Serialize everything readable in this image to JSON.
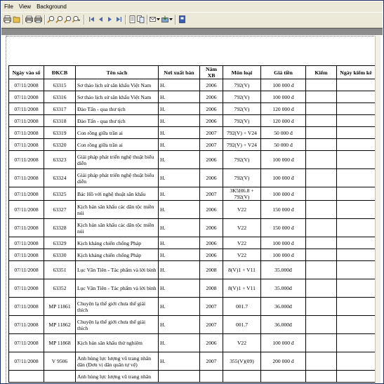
{
  "menu": [
    "File",
    "View",
    "Background"
  ],
  "toolbar_icons": [
    "print-icon",
    "open-icon",
    "print-setup-icon",
    "export-icon",
    "zoom-in-icon",
    "zoom-out-icon",
    "zoom-icon",
    "zoom-dropdown-icon",
    "first-page-icon",
    "prev-page-icon",
    "next-page-icon",
    "last-page-icon",
    "page-icon",
    "multi-page-icon",
    "email-icon",
    "save-icon",
    "watermark-icon",
    "help-icon"
  ],
  "table": {
    "headers": [
      "Ngày vào sổ",
      "ĐKCB",
      "Tên sách",
      "Nơi xuất bản",
      "Năm XB",
      "Môn loại",
      "Giá tiền",
      "Kiểm",
      "Ngày kiểm kê"
    ],
    "rows": [
      [
        "07/11/2008",
        "63315",
        "Sơ thảo lịch sử sân khấu Việt Nam",
        "H.",
        "2006",
        "792(V)",
        "100 000 đ",
        "",
        ""
      ],
      [
        "07/11/2008",
        "63316",
        "Sơ thảo lịch sử sân khấu Việt Nam",
        "H.",
        "2006",
        "792(V)",
        "100 000 đ",
        "",
        ""
      ],
      [
        "07/11/2008",
        "63317",
        "Đào Tấn - qua thư tịch",
        "H.",
        "2006",
        "792(V)",
        "120 000 đ",
        "",
        ""
      ],
      [
        "07/11/2008",
        "63318",
        "Đào Tấn - qua thư tịch",
        "H.",
        "2006",
        "792(V)",
        "120 000 đ",
        "",
        ""
      ],
      [
        "07/11/2008",
        "63319",
        "Con rồng giữa trần ai",
        "H.",
        "2007",
        "792(V) + V24",
        "50 000 đ",
        "",
        ""
      ],
      [
        "07/11/2008",
        "63320",
        "Con rồng giữa trần ai",
        "H.",
        "2007",
        "792(V) + V24",
        "50 000 đ",
        "",
        ""
      ],
      [
        "07/11/2008",
        "63323",
        "Giải pháp phát triển nghệ thuật biểu diễn",
        "H.",
        "2006",
        "792(V)",
        "100 000 đ",
        "",
        ""
      ],
      [
        "07/11/2008",
        "63324",
        "Giải pháp phát triển nghệ thuật biểu diễn",
        "H.",
        "2006",
        "792(V)",
        "100 000 đ",
        "",
        ""
      ],
      [
        "07/11/2008",
        "63325",
        "Bác Hồ với nghệ thuật sân khấu",
        "H.",
        "2007",
        "3K5H6.8 + 792(V)",
        "100 000 đ",
        "",
        ""
      ],
      [
        "07/11/2008",
        "63327",
        "Kịch bản sân khấu các dân tộc miền núi",
        "H.",
        "2006",
        "V22",
        "150 000 đ",
        "",
        ""
      ],
      [
        "07/11/2008",
        "63328",
        "Kịch bản sân khấu các dân tộc miền núi",
        "H.",
        "2006",
        "V22",
        "150 000 đ",
        "",
        ""
      ],
      [
        "07/11/2008",
        "63329",
        "Kịch kháng chiến chống Pháp",
        "H.",
        "2006",
        "V22",
        "100 000 đ",
        "",
        ""
      ],
      [
        "07/11/2008",
        "63330",
        "Kịch kháng chiến chống Pháp",
        "H.",
        "2006",
        "V22",
        "100 000 đ",
        "",
        ""
      ],
      [
        "07/11/2008",
        "63351",
        "Lục Vân Tiên - Tác phẩm và lời bình",
        "H.",
        "2008",
        "8(V)1 + V11",
        "35.000đ",
        "",
        ""
      ],
      [
        "07/11/2008",
        "63352",
        "Lục Vân Tiên - Tác phẩm và lời bình",
        "H.",
        "2008",
        "8(V)1 + V11",
        "35.000đ",
        "",
        ""
      ],
      [
        "07/11/2008",
        "MP 11861",
        "Chuyện lạ thế giới chưa thể giải thích",
        "H.",
        "2007",
        "001.7",
        "36.000đ",
        "",
        ""
      ],
      [
        "07/11/2008",
        "MP 11862",
        "Chuyện lạ thế giới chưa thể giải thích",
        "H.",
        "2007",
        "001.7",
        "36.000đ",
        "",
        ""
      ],
      [
        "07/11/2008",
        "MP 11868",
        "Kịch bản sân khấu thử nghiệm",
        "H.",
        "2006",
        "V22",
        "100 000 đ",
        "",
        ""
      ],
      [
        "07/11/2008",
        "V 9506",
        "Anh hùng lực lượng vũ trang nhân dân (Đơn vị dân quân tự vệ)",
        "H.",
        "2007",
        "355(V)(09)",
        "200 000 đ",
        "",
        ""
      ],
      [
        "",
        "",
        "Anh hùng lực lượng vũ trang nhân",
        "",
        "",
        "",
        "",
        "",
        ""
      ]
    ]
  }
}
